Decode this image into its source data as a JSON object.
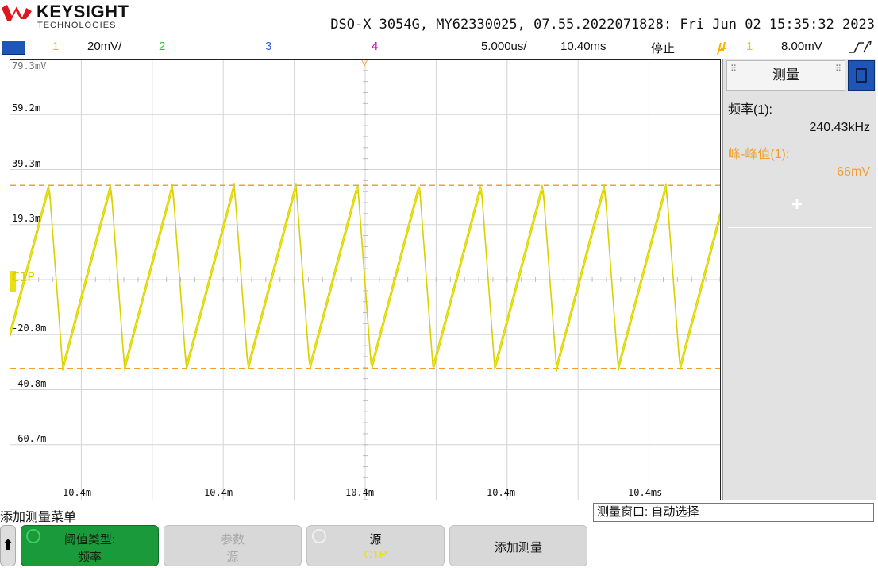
{
  "brand": {
    "name": "KEYSIGHT",
    "sub": "TECHNOLOGIES",
    "logo_color": "#e0161e"
  },
  "instrument_info": "DSO-X 3054G, MY62330025, 07.55.2022071828: Fri Jun 02 15:35:32 2023",
  "channel_bar": {
    "ch1_num": "1",
    "ch1_scale": "20mV/",
    "ch2_num": "2",
    "ch3_num": "3",
    "ch4_num": "4",
    "timebase": "5.000us/",
    "delay": "10.40ms",
    "run_state": "停止",
    "trigger_icon": "trigger-edge-icon",
    "trigger_source": "1",
    "trigger_level": "8.00mV",
    "trigger_mode_icon": "edge-slope-icon",
    "colors": {
      "ch1": "#e8e010",
      "ch2": "#22cc22",
      "ch3": "#3a64e0",
      "ch4": "#e000b0",
      "trigger": "#ff9900"
    }
  },
  "screen": {
    "y_labels": [
      "79.3mV",
      "59.2m",
      "39.3m",
      "19.3m",
      "-20.8m",
      "-40.8m",
      "-60.7m"
    ],
    "x_labels": [
      "10.4m",
      "10.4m",
      "10.4m",
      "10.4m",
      "10.4ms"
    ],
    "trace_label": "C1P",
    "cursor_upper_mv": 34,
    "cursor_lower_mv": -32,
    "trace_color": "#ecea16",
    "cursor_color": "#f0a030"
  },
  "chart_data": {
    "type": "line",
    "title": "",
    "xlabel": "",
    "ylabel": "",
    "ylim": [
      -79.3,
      79.3
    ],
    "series": [
      {
        "name": "C1P",
        "color": "#ecea16",
        "approx_peaks_mV": 34,
        "approx_troughs_mV": -32,
        "shape": "sawtooth",
        "approx_cycles_visible": 11
      }
    ]
  },
  "measure_panel": {
    "title": "测量",
    "freq_label": "频率(1):",
    "freq_value": "240.43kHz",
    "pp_label": "峰-峰值(1):",
    "pp_value": "66mV",
    "add_symbol": "+"
  },
  "bottom": {
    "menu_title": "添加测量菜单",
    "window_label": "测量窗口: 自动选择",
    "back_icon": "up-arrow-icon",
    "keys": [
      {
        "line1": "阈值类型:",
        "line2": "频率"
      },
      {
        "line1": "参数",
        "line2": "源"
      },
      {
        "line1": "源",
        "line2": "C1P"
      },
      {
        "line1": "添加测量",
        "line2": ""
      }
    ]
  }
}
